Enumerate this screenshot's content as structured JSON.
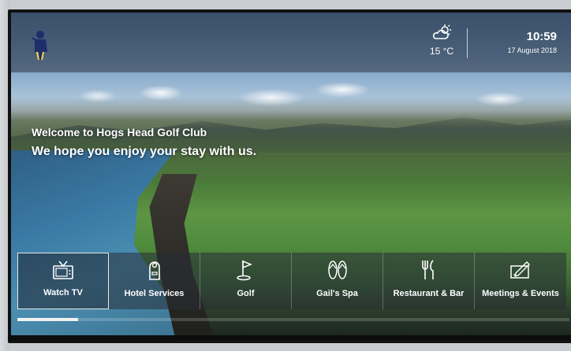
{
  "club": {
    "logo_icon": "golfer-logo-icon"
  },
  "weather": {
    "icon": "partly-cloudy-icon",
    "temperature": "15 °C"
  },
  "clock": {
    "time": "10:59",
    "date": "17 August 2018"
  },
  "welcome": {
    "line1": "Welcome to Hogs Head Golf Club",
    "line2": "We hope you enjoy your stay with us."
  },
  "menu": {
    "items": [
      {
        "label": "Watch TV",
        "icon": "tv-icon"
      },
      {
        "label": "Hotel Services",
        "icon": "door-hanger-icon"
      },
      {
        "label": "Golf",
        "icon": "golf-flag-icon"
      },
      {
        "label": "Gail's Spa",
        "icon": "flip-flops-icon"
      },
      {
        "label": "Restaurant & Bar",
        "icon": "cutlery-icon"
      },
      {
        "label": "Meetings & Events",
        "icon": "pen-paper-icon"
      }
    ],
    "selected_index": 0,
    "progress": 0.11
  },
  "colors": {
    "accent": "#ffffff",
    "overlay": "#2d3746"
  }
}
